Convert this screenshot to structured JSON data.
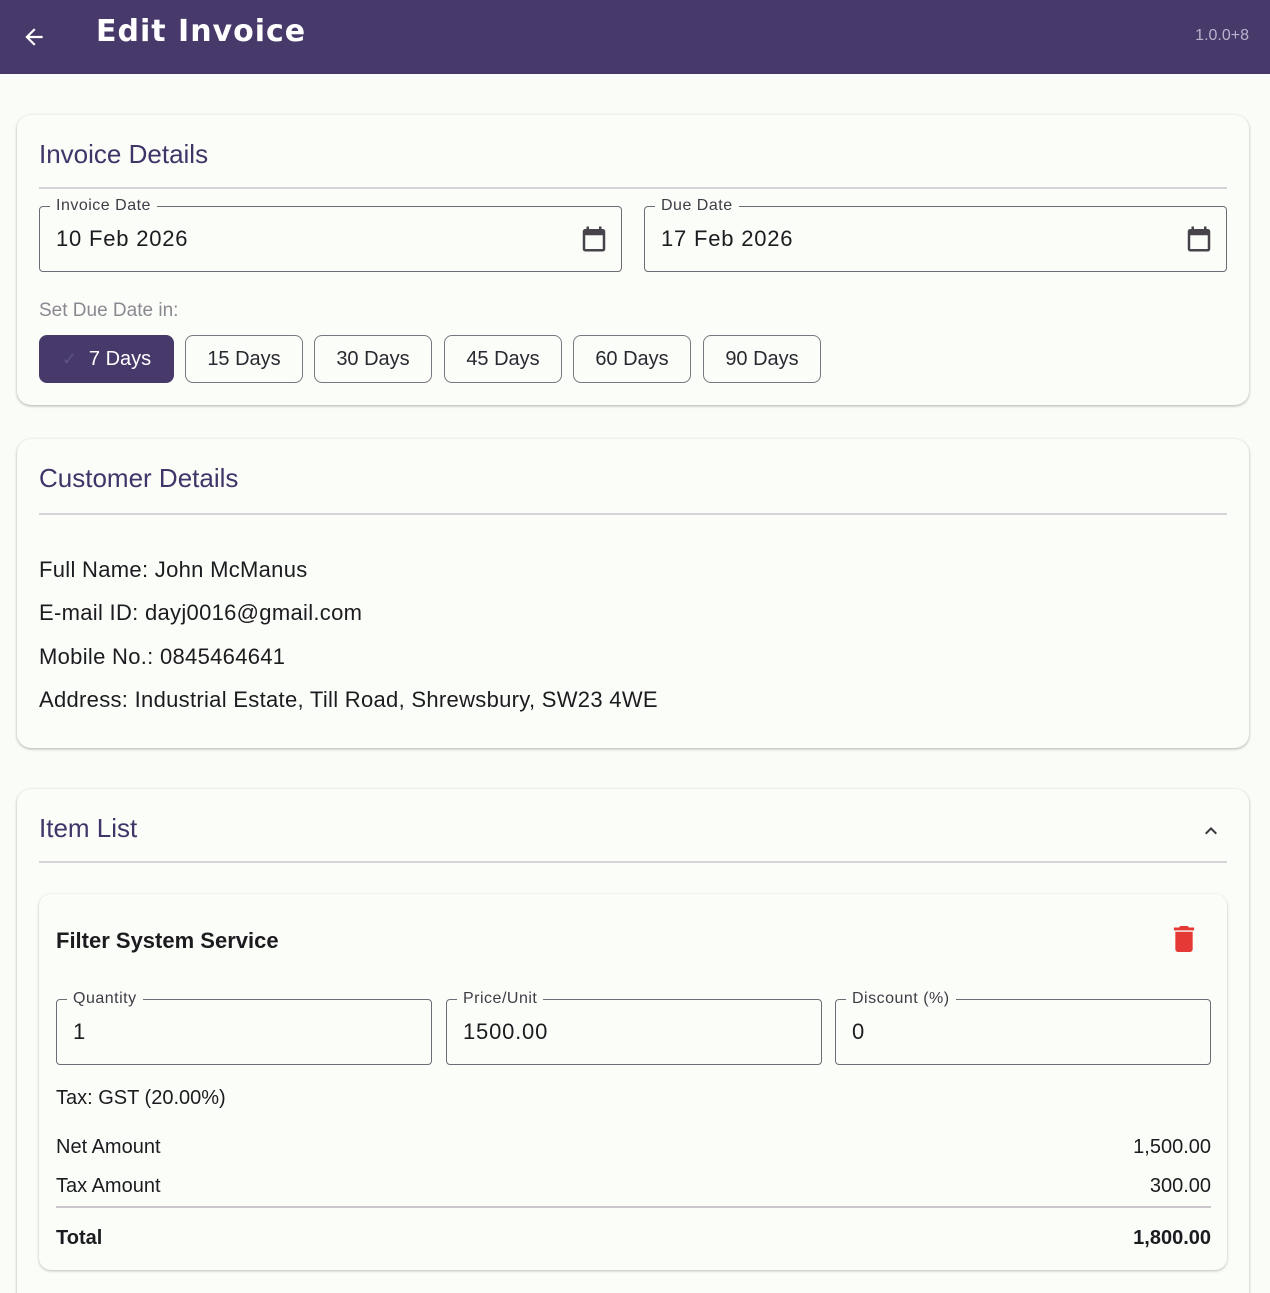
{
  "app_bar": {
    "title": "Edit Invoice",
    "version": "1.0.0+8",
    "color": "#473a6b"
  },
  "invoice_details": {
    "title": "Invoice Details",
    "invoice_date": {
      "label": "Invoice Date",
      "value": "10 Feb 2026"
    },
    "due_date": {
      "label": "Due Date",
      "value": "17 Feb 2026"
    },
    "set_due_label": "Set Due Date in:",
    "chips": [
      {
        "label": "7 Days",
        "selected": true
      },
      {
        "label": "15 Days",
        "selected": false
      },
      {
        "label": "30 Days",
        "selected": false
      },
      {
        "label": "45 Days",
        "selected": false
      },
      {
        "label": "60 Days",
        "selected": false
      },
      {
        "label": "90 Days",
        "selected": false
      }
    ]
  },
  "customer_details": {
    "title": "Customer Details",
    "full_name": "Full Name: John McManus",
    "email": "E-mail ID: dayj0016@gmail.com",
    "mobile": "Mobile No.: 0845464641",
    "address": "Address: Industrial Estate, Till Road, Shrewsbury, SW23 4WE"
  },
  "item_list": {
    "title": "Item List",
    "expanded": true,
    "items": [
      {
        "name": "Filter System Service",
        "quantity": {
          "label": "Quantity",
          "value": "1"
        },
        "price": {
          "label": "Price/Unit",
          "value": "1500.00"
        },
        "discount": {
          "label": "Discount (%)",
          "value": "0"
        },
        "tax": "Tax: GST (20.00%)",
        "net_label": "Net Amount",
        "net_value": "1,500.00",
        "tax_label": "Tax Amount",
        "tax_value": "300.00",
        "total_label": "Total",
        "total_value": "1,800.00"
      }
    ]
  },
  "colors": {
    "primary": "#473a6b",
    "delete": "#e53935"
  }
}
